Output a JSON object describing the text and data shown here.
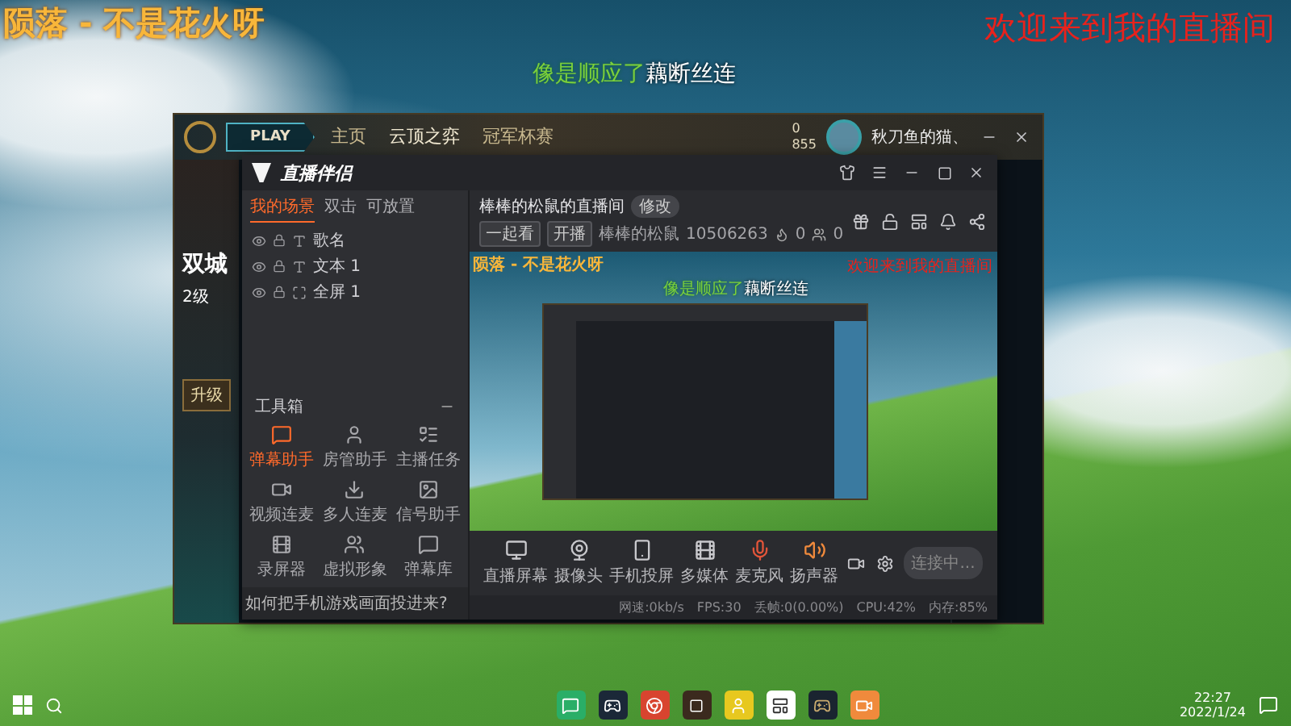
{
  "overlay": {
    "song": "陨落 - 不是花火呀",
    "lyric_sung": "像是顺应了",
    "lyric_rest": "藕断丝连",
    "welcome": "欢迎来到我的直播间"
  },
  "game_window": {
    "play": "PLAY",
    "nav": [
      {
        "label": "主页",
        "selected": false
      },
      {
        "label": "云顶之弈",
        "selected": true
      },
      {
        "label": "冠军杯赛",
        "selected": false
      }
    ],
    "blue_essence": "0",
    "rp": "855",
    "summoner": "秋刀鱼的猫、",
    "event_title": "双城",
    "level": "2级",
    "upgrade": "升级"
  },
  "streamer": {
    "title": "直播伴侣",
    "scene_tabs": [
      {
        "label": "我的场景",
        "selected": true
      },
      {
        "label": "双击",
        "selected": false
      },
      {
        "label": "可放置",
        "selected": false
      }
    ],
    "sources": [
      {
        "kind": "text",
        "label": "歌名"
      },
      {
        "kind": "text",
        "label": "文本 1"
      },
      {
        "kind": "screen",
        "label": "全屏 1"
      }
    ],
    "toolbox_title": "工具箱",
    "tools": [
      {
        "label": "弹幕助手",
        "active": true
      },
      {
        "label": "房管助手",
        "active": false
      },
      {
        "label": "主播任务",
        "active": false
      },
      {
        "label": "视频连麦",
        "active": false
      },
      {
        "label": "多人连麦",
        "active": false
      },
      {
        "label": "信号助手",
        "active": false
      },
      {
        "label": "录屏器",
        "active": false
      },
      {
        "label": "虚拟形象",
        "active": false
      },
      {
        "label": "弹幕库",
        "active": false
      }
    ],
    "tip": "如何把手机游戏画面投进来?",
    "room_title": "棒棒的松鼠的直播间",
    "edit": "修改",
    "tags": [
      "一起看",
      "开播"
    ],
    "nickname": "棒棒的松鼠",
    "room_id": "10506263",
    "hot": "0",
    "fans": "0",
    "preview": {
      "song": "陨落 - 不是花火呀",
      "lyric_sung": "像是顺应了",
      "lyric_rest": "藕断丝连",
      "welcome": "欢迎来到我的直播间"
    },
    "inputs": [
      {
        "kind": "screen",
        "label": "直播屏幕"
      },
      {
        "kind": "camera",
        "label": "摄像头"
      },
      {
        "kind": "phone",
        "label": "手机投屏"
      },
      {
        "kind": "media",
        "label": "多媒体"
      },
      {
        "kind": "mic",
        "label": "麦克风"
      },
      {
        "kind": "speaker",
        "label": "扬声器"
      }
    ],
    "start_button": "连接中...",
    "status": [
      "网速:0kb/s",
      "FPS:30",
      "丢帧:0(0.00%)",
      "CPU:42%",
      "内存:85%"
    ]
  },
  "taskbar": {
    "time": "22:27",
    "date": "2022/1/24"
  }
}
